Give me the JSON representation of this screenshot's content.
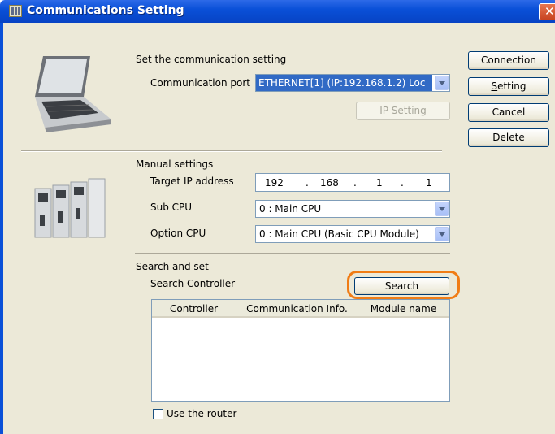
{
  "window": {
    "title": "Communications Setting"
  },
  "communication": {
    "heading": "Set the communication setting",
    "port_label": "Communication port",
    "port_value": "ETHERNET[1] (IP:192.168.1.2) Loc",
    "ip_setting_button": "IP Setting"
  },
  "side_buttons": {
    "connection": "Connection",
    "setting_mnemonic": "S",
    "setting_rest": "etting",
    "cancel": "Cancel",
    "delete": "Delete"
  },
  "manual": {
    "heading": "Manual settings",
    "target_ip_label": "Target IP address",
    "ip": [
      "192",
      "168",
      "1",
      "1"
    ],
    "ip_dot": ".",
    "sub_cpu_label": "Sub CPU",
    "sub_cpu_value": "0 : Main CPU",
    "option_cpu_label": "Option CPU",
    "option_cpu_value": "0 : Main CPU (Basic CPU Module)"
  },
  "search": {
    "heading": "Search and set",
    "controller_label": "Search Controller",
    "button": "Search",
    "columns": [
      "Controller",
      "Communication Info.",
      "Module name"
    ],
    "rows": []
  },
  "router": {
    "label": "Use the router",
    "checked": false
  },
  "colors": {
    "titlebar": "#0a50d8",
    "highlight": "#f07c15",
    "dialog_bg": "#ece9d8"
  }
}
